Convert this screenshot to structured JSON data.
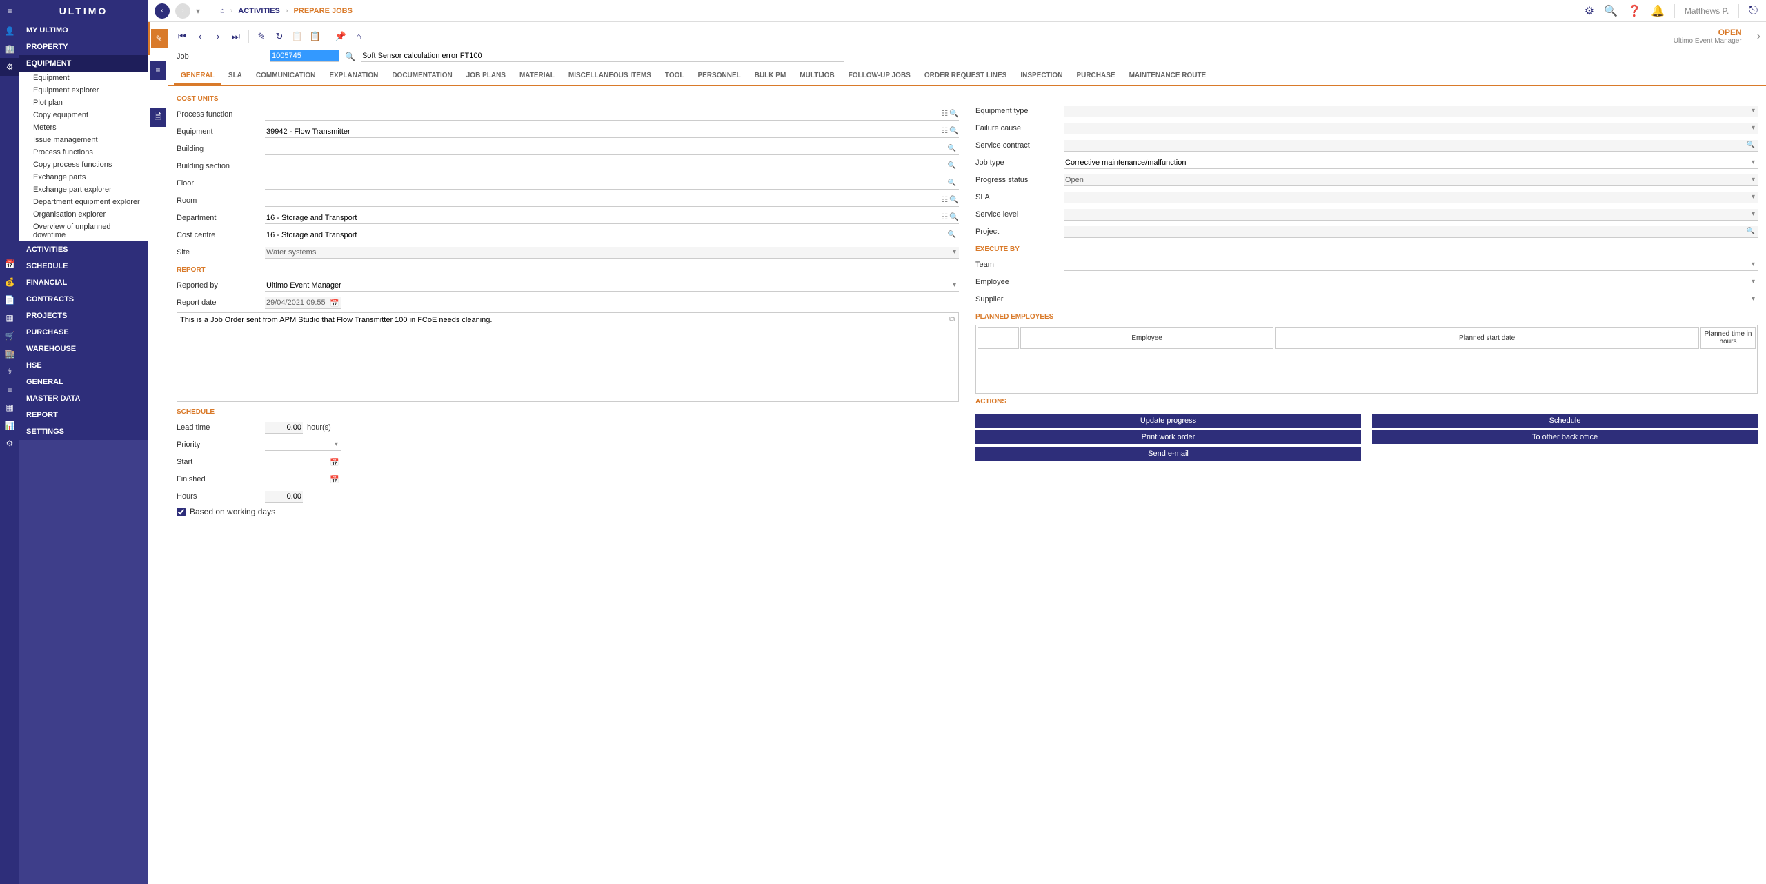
{
  "logo_text": "ULTIMO",
  "topbar": {
    "home_icon": "⌂",
    "activities_label": "ACTIVITIES",
    "prepare_jobs_label": "PREPARE JOBS",
    "gear_icon": "⚙",
    "search_icon": "🔍",
    "help_icon": "❓",
    "bell_icon": "🔔",
    "username": "Matthews P.",
    "logout_icon": "⎋"
  },
  "sidebar_icons": [
    "👤",
    "🏢",
    "⚙",
    "",
    "",
    "📅",
    "💰",
    "📄",
    "▦",
    "🛒",
    "🏬",
    "⚕",
    "≡",
    "▦",
    "📊",
    "⚙"
  ],
  "sidebar": {
    "my_ultimo": "MY ULTIMO",
    "property": "PROPERTY",
    "equipment": "EQUIPMENT",
    "eq_items": [
      "Equipment",
      "Equipment explorer",
      "Plot plan",
      "Copy equipment",
      "Meters",
      "Issue management",
      "Process functions",
      "Copy process functions",
      "Exchange parts",
      "Exchange part explorer",
      "Department equipment explorer",
      "Organisation explorer",
      "Overview of unplanned downtime"
    ],
    "activities": "ACTIVITIES",
    "schedule": "SCHEDULE",
    "financial": "FINANCIAL",
    "contracts": "CONTRACTS",
    "projects": "PROJECTS",
    "purchase": "PURCHASE",
    "warehouse": "WAREHOUSE",
    "hse": "HSE",
    "general": "GENERAL",
    "master_data": "MASTER DATA",
    "report": "REPORT",
    "settings": "SETTINGS"
  },
  "toolbar": {
    "first": "⏮",
    "prev": "‹",
    "next": "›",
    "last": "⏭",
    "edit": "✎",
    "refresh": "↻",
    "copy": "📋",
    "paste": "📋",
    "pin": "📌",
    "home": "⌂",
    "status": "OPEN",
    "status_sub": "Ultimo Event Manager"
  },
  "job": {
    "label": "Job",
    "id": "1005745",
    "desc": "Soft Sensor calculation error FT100"
  },
  "tabs": [
    "GENERAL",
    "SLA",
    "COMMUNICATION",
    "EXPLANATION",
    "DOCUMENTATION",
    "JOB PLANS",
    "MATERIAL",
    "MISCELLANEOUS ITEMS",
    "TOOL",
    "PERSONNEL",
    "BULK PM",
    "MULTIJOB",
    "FOLLOW-UP JOBS",
    "ORDER REQUEST LINES",
    "INSPECTION",
    "PURCHASE",
    "MAINTENANCE ROUTE"
  ],
  "form": {
    "cost_units_title": "COST UNITS",
    "process_function_label": "Process function",
    "process_function_val": "",
    "equipment_label": "Equipment",
    "equipment_val": "39942 - Flow Transmitter",
    "building_label": "Building",
    "building_val": "",
    "building_section_label": "Building section",
    "building_section_val": "",
    "floor_label": "Floor",
    "floor_val": "",
    "room_label": "Room",
    "room_val": "",
    "department_label": "Department",
    "department_val": "16 - Storage and Transport",
    "cost_centre_label": "Cost centre",
    "cost_centre_val": "16 - Storage and Transport",
    "site_label": "Site",
    "site_val": "Water systems",
    "report_title": "REPORT",
    "reported_by_label": "Reported by",
    "reported_by_val": "Ultimo Event Manager",
    "report_date_label": "Report date",
    "report_date_val": "29/04/2021 09:55",
    "report_text": "This is a Job Order sent from APM Studio that Flow Transmitter 100 in FCoE needs cleaning.",
    "schedule_title": "SCHEDULE",
    "lead_time_label": "Lead time",
    "lead_time_val": "0.00",
    "lead_time_unit": "hour(s)",
    "priority_label": "Priority",
    "priority_val": "",
    "start_label": "Start",
    "start_val": "",
    "finished_label": "Finished",
    "finished_val": "",
    "hours_label": "Hours",
    "hours_val": "0.00",
    "working_days_label": "Based on working days",
    "equipment_type_label": "Equipment type",
    "equipment_type_val": "",
    "failure_cause_label": "Failure cause",
    "failure_cause_val": "",
    "service_contract_label": "Service contract",
    "service_contract_val": "",
    "job_type_label": "Job type",
    "job_type_val": "Corrective maintenance/malfunction",
    "progress_status_label": "Progress status",
    "progress_status_val": "Open",
    "sla_label": "SLA",
    "sla_val": "",
    "service_level_label": "Service level",
    "service_level_val": "",
    "project_label": "Project",
    "project_val": "",
    "execute_by_title": "EXECUTE BY",
    "team_label": "Team",
    "team_val": "",
    "employee_label": "Employee",
    "employee_val": "",
    "supplier_label": "Supplier",
    "supplier_val": "",
    "planned_emp_title": "PLANNED EMPLOYEES",
    "emp_cols": [
      "",
      "Employee",
      "Planned start date",
      "Planned time in hours"
    ],
    "actions_title": "ACTIONS",
    "action_update": "Update progress",
    "action_schedule": "Schedule",
    "action_print": "Print work order",
    "action_back_office": "To other back office",
    "action_email": "Send e-mail"
  }
}
